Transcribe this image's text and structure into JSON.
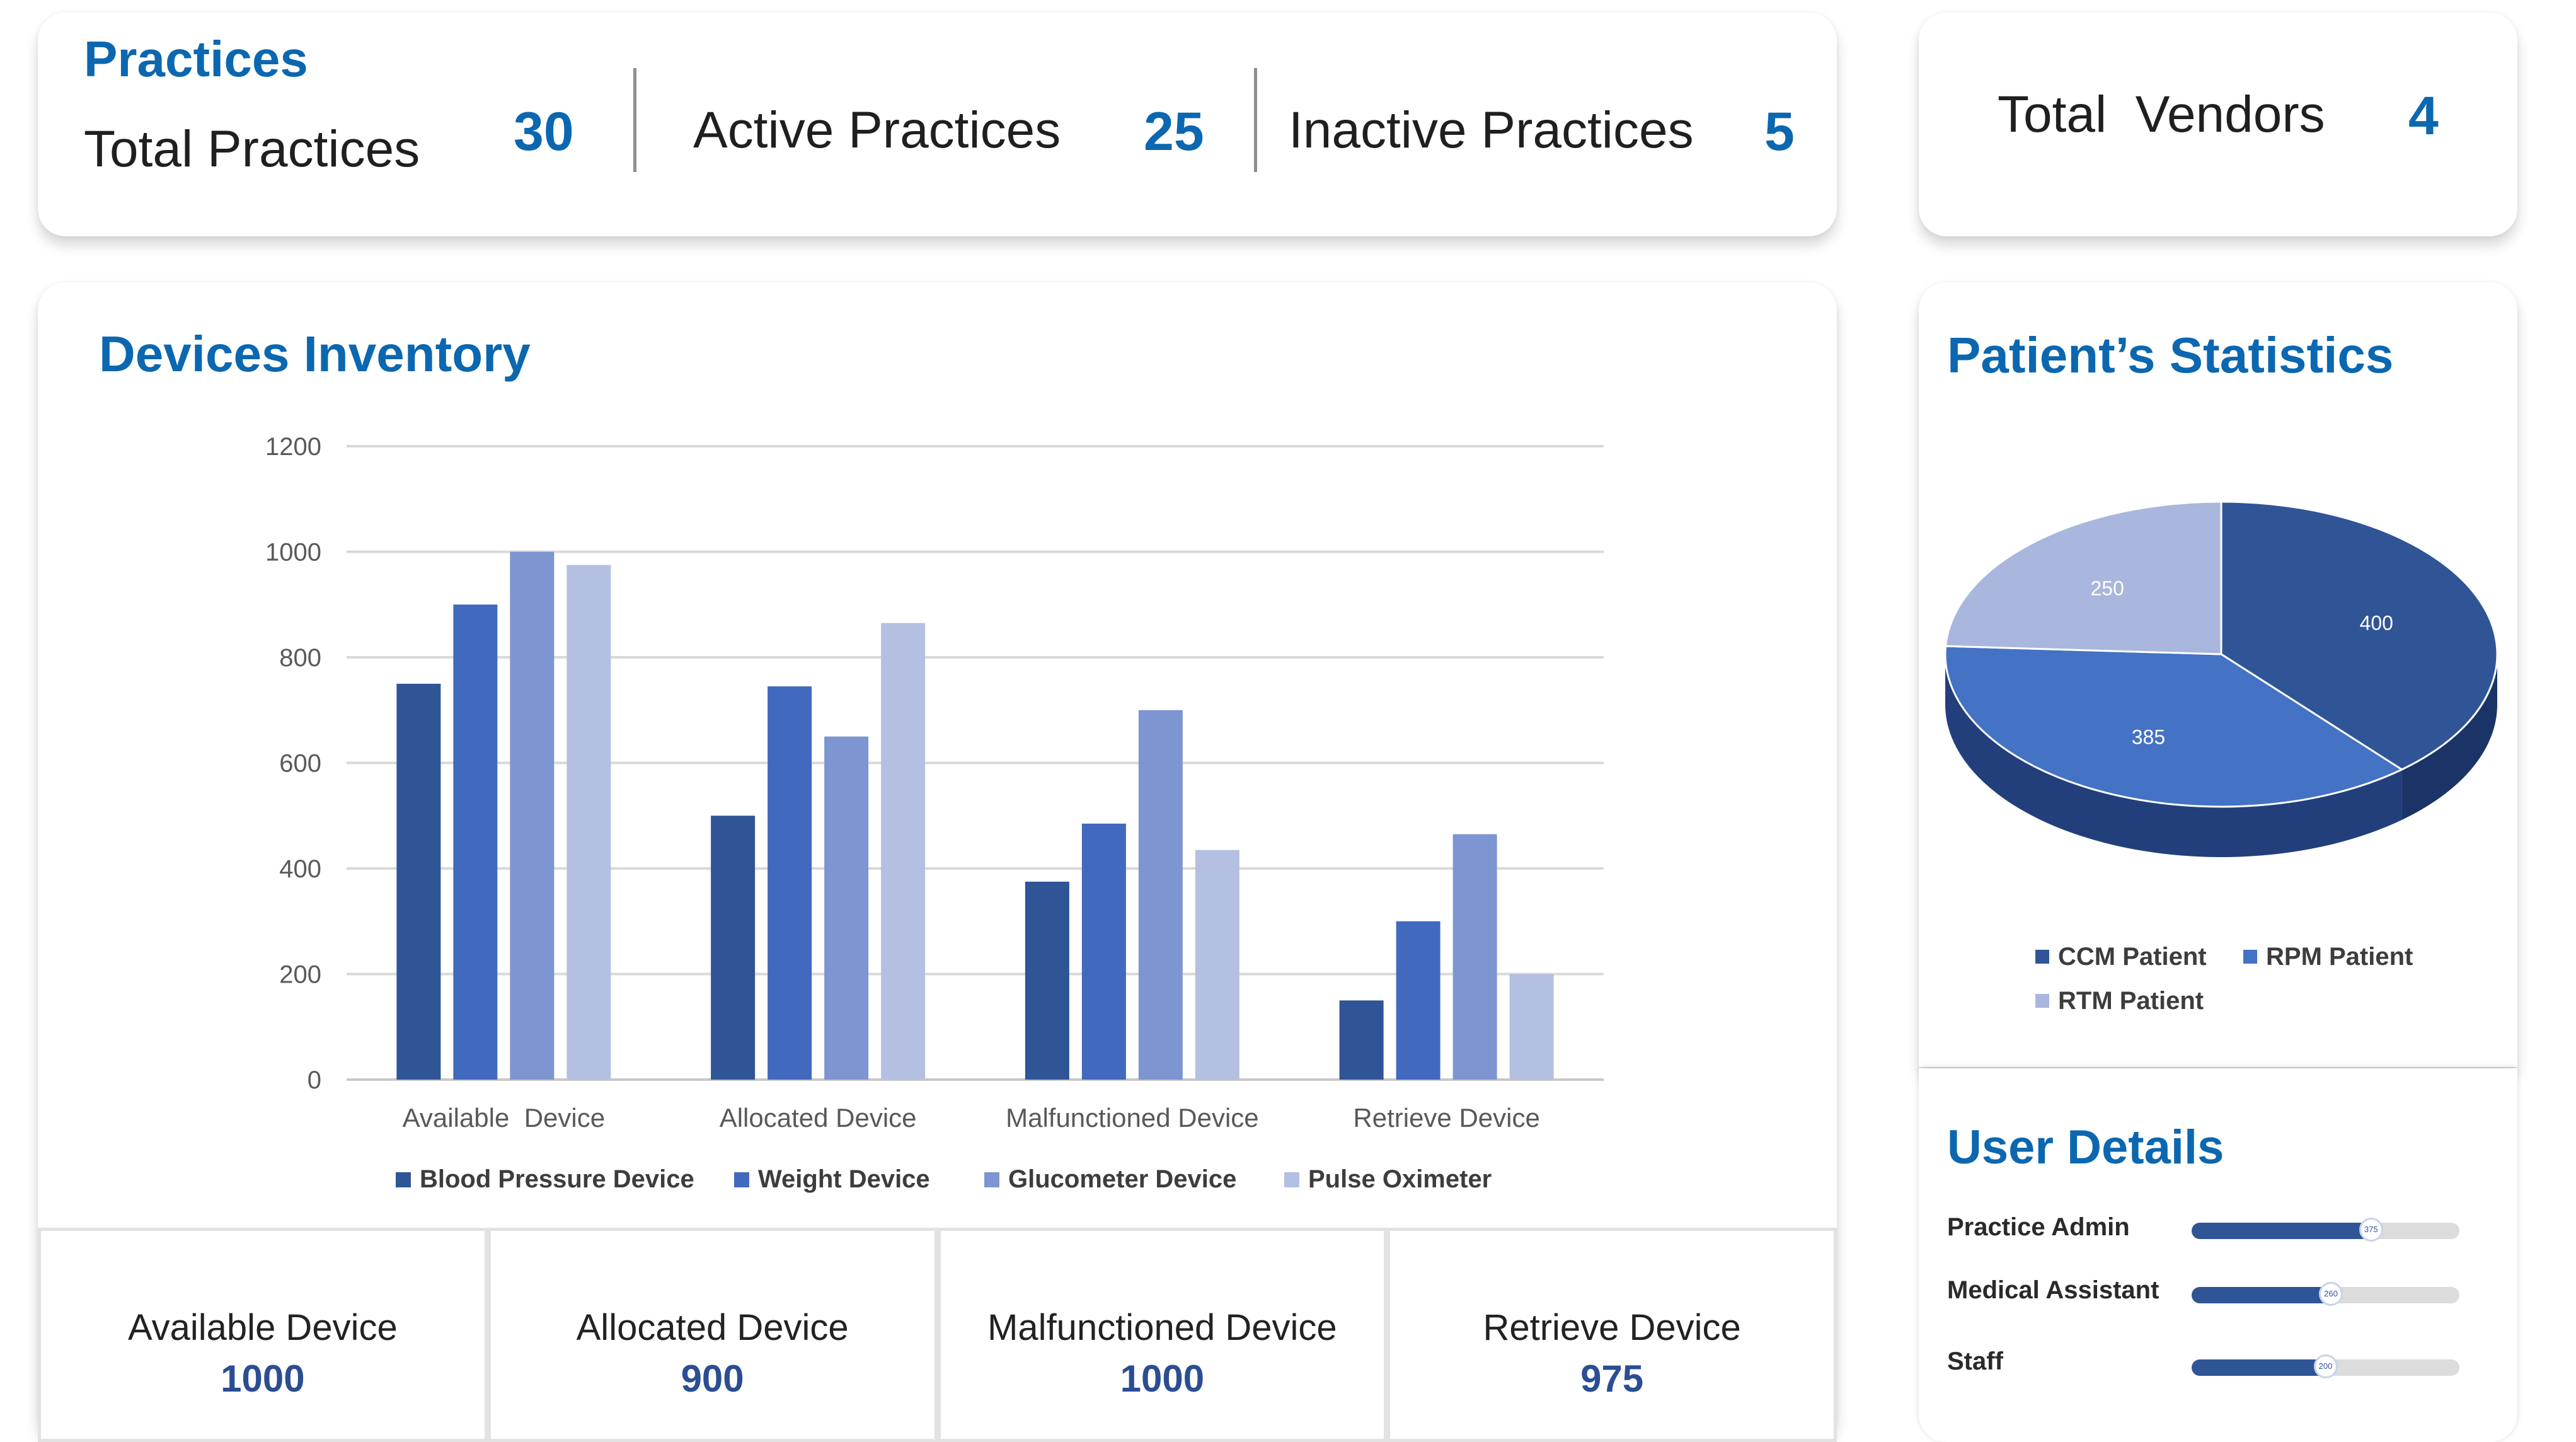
{
  "practices": {
    "title": "Practices",
    "total_label": "Total Practices",
    "total_value": "30",
    "active_label": "Active Practices",
    "active_value": "25",
    "inactive_label": "Inactive Practices",
    "inactive_value": "5"
  },
  "vendors": {
    "label": "Total  Vendors",
    "value": "4"
  },
  "devices": {
    "title": "Devices Inventory",
    "summary": [
      {
        "label": "Available Device",
        "value": "1000"
      },
      {
        "label": "Allocated Device",
        "value": "900"
      },
      {
        "label": "Malfunctioned Device",
        "value": "1000"
      },
      {
        "label": "Retrieve Device",
        "value": "975"
      }
    ]
  },
  "chart_data": [
    {
      "type": "bar",
      "categories": [
        "Available  Device",
        "Allocated Device",
        "Malfunctioned Device",
        "Retrieve Device"
      ],
      "series": [
        {
          "name": "Blood Pressure Device",
          "values": [
            750,
            500,
            375,
            150
          ],
          "color": "#2f5597"
        },
        {
          "name": "Weight Device",
          "values": [
            900,
            745,
            485,
            300
          ],
          "color": "#4169bd"
        },
        {
          "name": "Glucometer Device",
          "values": [
            1000,
            650,
            700,
            465
          ],
          "color": "#7d95d0"
        },
        {
          "name": "Pulse Oximeter",
          "values": [
            975,
            865,
            435,
            200
          ],
          "color": "#b4c0e2"
        }
      ],
      "yticks": [
        "0",
        "200",
        "400",
        "600",
        "800",
        "1000",
        "1200"
      ],
      "ylim": [
        0,
        1200
      ],
      "grid": true,
      "legend": "bottom"
    },
    {
      "type": "pie",
      "title": "Patient’s Statistics",
      "labels": [
        "CCM Patient",
        "RPM Patient",
        "RTM Patient"
      ],
      "values": [
        400,
        385,
        250
      ],
      "data_labels": [
        "400",
        "385",
        "250"
      ],
      "colors": [
        "#2f5597",
        "#4472c4",
        "#a9b6dd"
      ],
      "style": "3d",
      "legend": "bottom"
    }
  ],
  "stats": {
    "title": "Patient’s Statistics"
  },
  "users": {
    "title": "User Details",
    "items": [
      {
        "label": "Practice Admin",
        "value": "375",
        "fraction": 0.67
      },
      {
        "label": "Medical Assistant",
        "value": "260",
        "fraction": 0.52
      },
      {
        "label": "Staff",
        "value": "200",
        "fraction": 0.5
      }
    ]
  }
}
